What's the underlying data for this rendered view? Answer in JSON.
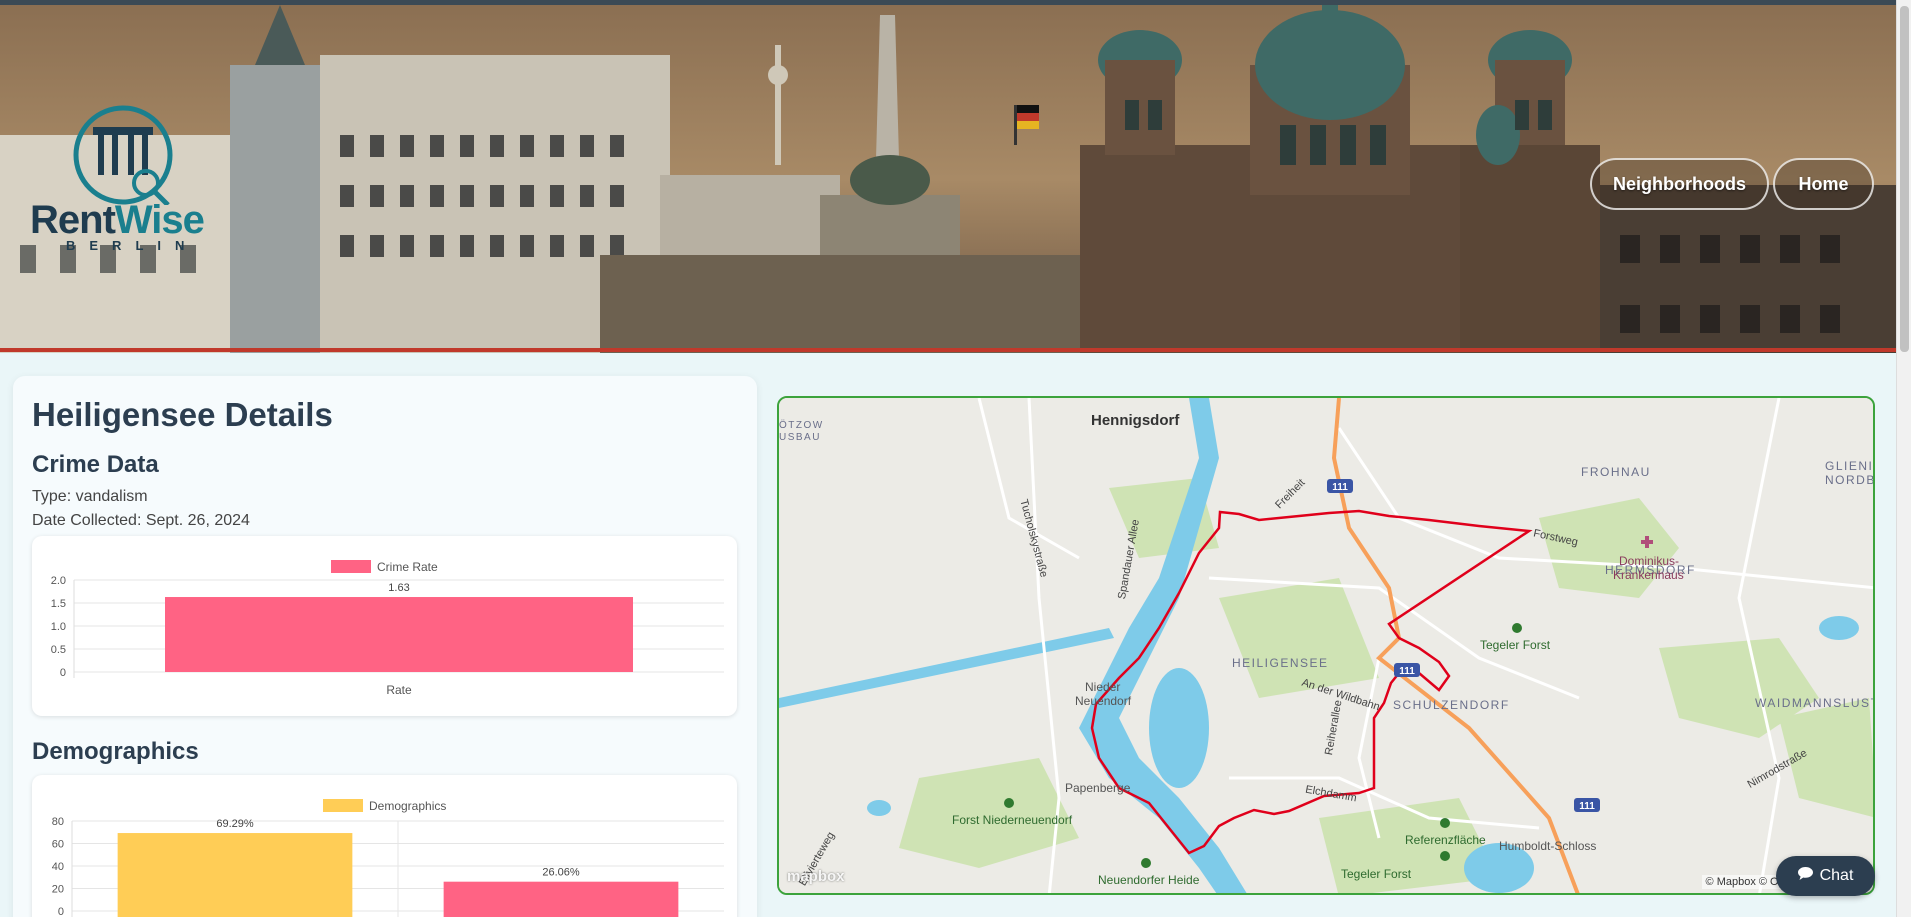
{
  "brand": {
    "name_part1": "Rent",
    "name_part2": "Wise",
    "city": "BERLIN"
  },
  "nav": {
    "neighborhoods": "Neighborhoods",
    "home": "Home"
  },
  "details": {
    "title": "Heiligensee Details",
    "crime_section": "Crime Data",
    "type_line": "Type: vandalism",
    "date_line": "Date Collected: Sept. 26, 2024",
    "demographics_section": "Demographics"
  },
  "chart_data": [
    {
      "type": "bar",
      "categories": [
        "Rate"
      ],
      "series": [
        {
          "name": "Crime Rate",
          "values": [
            1.63
          ]
        }
      ],
      "data_labels": [
        "1.63"
      ],
      "ylim": [
        0,
        2.0
      ],
      "yticks": [
        "2.0",
        "1.5",
        "1.0",
        "0.5",
        "0"
      ],
      "color": "#ff6384",
      "legend": "top"
    },
    {
      "type": "bar",
      "series": [
        {
          "name": "Demographics",
          "values": [
            69.29,
            26.06
          ]
        }
      ],
      "data_labels": [
        "69.29%",
        "26.06%"
      ],
      "colors": [
        "#ffcd56",
        "#ff6384"
      ],
      "ylim": [
        0,
        80
      ],
      "yticks": [
        "80",
        "60",
        "40",
        "20",
        "0"
      ],
      "legend": "top"
    }
  ],
  "map": {
    "places": {
      "hennigsdorf": "Hennigsdorf",
      "frohnau": "FROHNAU",
      "glienicke": "GLIENIC",
      "nordb": "NORDB",
      "hermsdorf": "HERMSDORF",
      "heiligensee": "HEILIGENSEE",
      "schulzendorf": "SCHULZENDORF",
      "waidmannslust": "WAIDMANNSLUST",
      "nieder": "Nieder",
      "neuendorf": "Neuendorf",
      "papenberge": "Papenberge",
      "otzow": "ÖTZOW",
      "usbau": "USBAU"
    },
    "forests": {
      "tegeler_forst": "Tegeler Forst",
      "tegeler_forst2": "Tegeler Forst",
      "forst_niederneuendorf": "Forst Niederneuendorf",
      "neuendorfer_heide": "Neuendorfer Heide",
      "referenzflaeche": "Referenzfläche"
    },
    "streets": {
      "tucholsky": "Tucholskystraße",
      "spandauer": "Spandauer Allee",
      "freiheit": "Freiheit",
      "forstweg": "Forstweg",
      "wildbahn": "An der Wildbahn",
      "reiherallee": "Reiherallee",
      "elchdamm": "Elchdamm",
      "nimrod": "Nimrodstraße",
      "elvert": "Elfvierteweg"
    },
    "pois": {
      "dominikus1": "Dominikus-",
      "dominikus2": "Krankenhaus",
      "humboldt": "Humboldt-Schloss"
    },
    "shields": [
      "111",
      "111",
      "111"
    ],
    "logo": "mapbox",
    "attribution": "© Mapbox © OpenStreetMap  Im"
  },
  "chat": {
    "label": "Chat"
  },
  "colors": {
    "accent_red": "#c0392b",
    "boundary": "#e0001b",
    "map_border": "#3ca33c"
  },
  "icons": {
    "chat": "chat-bubble-icon",
    "logo": "brandenburg-gate-magnifier-icon"
  }
}
